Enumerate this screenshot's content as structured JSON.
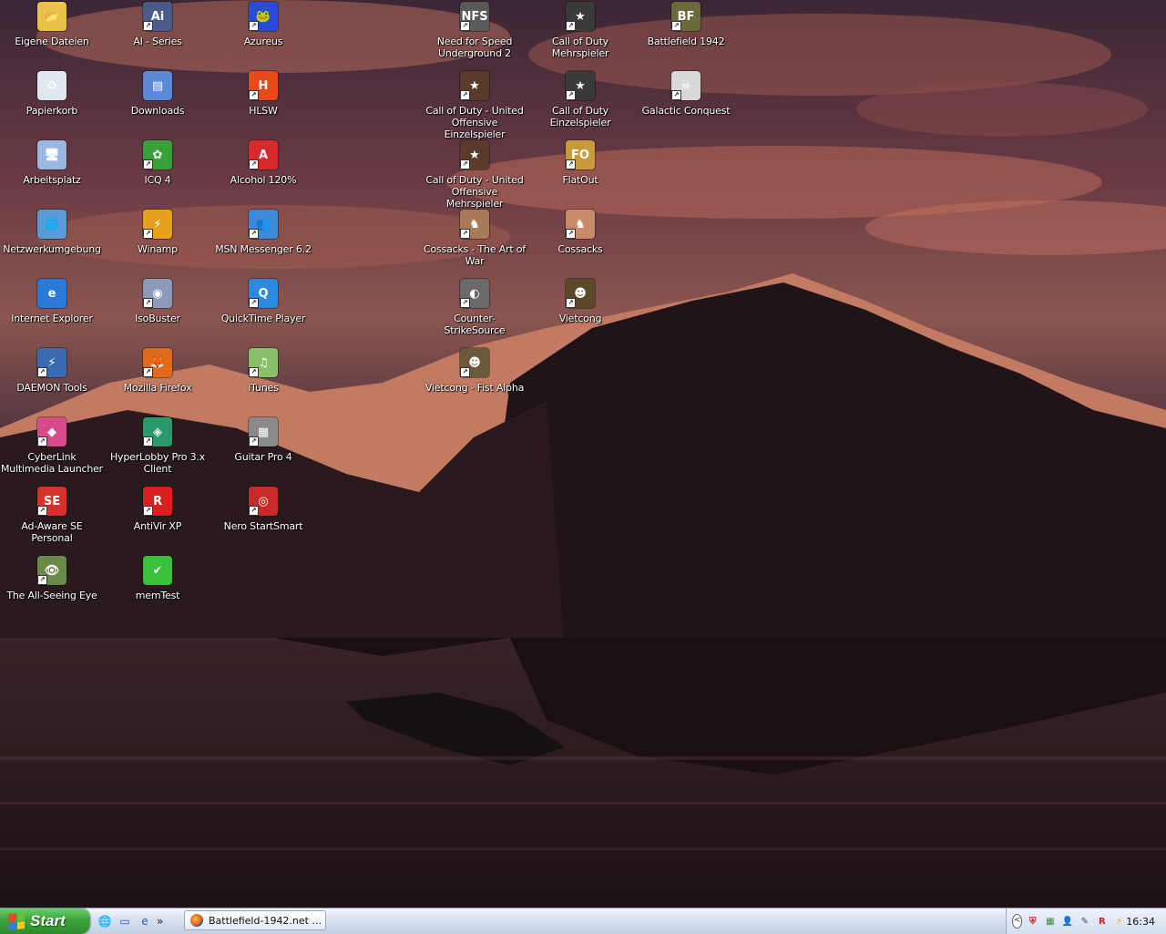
{
  "desktop": {
    "icons": [
      {
        "label": "Eigene Dateien",
        "glyph": "📂",
        "color": "#e9c24a",
        "shortcut": false
      },
      {
        "label": "Papierkorb",
        "glyph": "♻",
        "color": "#dfe8f0",
        "shortcut": false
      },
      {
        "label": "Arbeitsplatz",
        "glyph": "🖥",
        "color": "#9ab8e0",
        "shortcut": false
      },
      {
        "label": "Netzwerkumgebung",
        "glyph": "🌐",
        "color": "#5a9ad8",
        "shortcut": false
      },
      {
        "label": "Internet Explorer",
        "glyph": "e",
        "color": "#2a7ad8",
        "shortcut": false
      },
      {
        "label": "DAEMON Tools",
        "glyph": "⚡",
        "color": "#3a6ab0",
        "shortcut": true
      },
      {
        "label": "CyberLink Multimedia Launcher",
        "glyph": "◆",
        "color": "#d84a8a",
        "shortcut": true
      },
      {
        "label": "Ad-Aware SE Personal",
        "glyph": "SE",
        "color": "#d8302a",
        "shortcut": true
      },
      {
        "label": "The All-Seeing Eye",
        "glyph": "👁",
        "color": "#6a8a4a",
        "shortcut": true
      },
      {
        "label": "AI - Series",
        "glyph": "Ai",
        "color": "#4a5a8a",
        "shortcut": true
      },
      {
        "label": "Downloads",
        "glyph": "▤",
        "color": "#5a8ad8",
        "shortcut": false
      },
      {
        "label": "ICQ 4",
        "glyph": "✿",
        "color": "#3aa03a",
        "shortcut": true
      },
      {
        "label": "Winamp",
        "glyph": "⚡",
        "color": "#e8a020",
        "shortcut": true
      },
      {
        "label": "IsoBuster",
        "glyph": "◉",
        "color": "#8a9ab8",
        "shortcut": true
      },
      {
        "label": "Mozilla Firefox",
        "glyph": "🦊",
        "color": "#e06a1a",
        "shortcut": true
      },
      {
        "label": "HyperLobby Pro 3.x Client",
        "glyph": "◈",
        "color": "#2a9a6a",
        "shortcut": true
      },
      {
        "label": "AntiVir XP",
        "glyph": "R",
        "color": "#d82020",
        "shortcut": true
      },
      {
        "label": "memTest",
        "glyph": "✔",
        "color": "#3ac03a",
        "shortcut": false
      },
      {
        "label": "Azureus",
        "glyph": "🐸",
        "color": "#2a4ad8",
        "shortcut": true
      },
      {
        "label": "HLSW",
        "glyph": "H",
        "color": "#e84a1a",
        "shortcut": true
      },
      {
        "label": "Alcohol 120%",
        "glyph": "A",
        "color": "#d82a2a",
        "shortcut": true
      },
      {
        "label": "MSN Messenger 6.2",
        "glyph": "👥",
        "color": "#3a8ad8",
        "shortcut": true
      },
      {
        "label": "QuickTime Player",
        "glyph": "Q",
        "color": "#2a8ae0",
        "shortcut": true
      },
      {
        "label": "iTunes",
        "glyph": "♫",
        "color": "#8ac06a",
        "shortcut": true
      },
      {
        "label": "Guitar Pro 4",
        "glyph": "▦",
        "color": "#8a8a8a",
        "shortcut": true
      },
      {
        "label": "Nero StartSmart",
        "glyph": "◎",
        "color": "#c82a2a",
        "shortcut": true
      },
      {
        "label": "Need for Speed Underground 2",
        "glyph": "NFS",
        "color": "#5a5a5a",
        "shortcut": true
      },
      {
        "label": "Call of Duty - United Offensive Einzelspieler",
        "glyph": "★",
        "color": "#5a3a2a",
        "shortcut": true
      },
      {
        "label": "Call of Duty - United Offensive Mehrspieler",
        "glyph": "★",
        "color": "#5a3a2a",
        "shortcut": true
      },
      {
        "label": "Cossacks - The Art of War",
        "glyph": "♞",
        "color": "#a87a5a",
        "shortcut": true
      },
      {
        "label": "Counter-StrikeSource",
        "glyph": "◐",
        "color": "#6a6a6a",
        "shortcut": true
      },
      {
        "label": "Vietcong - Fist Alpha",
        "glyph": "☻",
        "color": "#6a5a3a",
        "shortcut": true
      },
      {
        "label": "Call of Duty Mehrspieler",
        "glyph": "★",
        "color": "#3a3a3a",
        "shortcut": true
      },
      {
        "label": "Call of Duty Einzelspieler",
        "glyph": "★",
        "color": "#3a3a3a",
        "shortcut": true
      },
      {
        "label": "FlatOut",
        "glyph": "FO",
        "color": "#c89a3a",
        "shortcut": true
      },
      {
        "label": "Cossacks",
        "glyph": "♞",
        "color": "#c88a6a",
        "shortcut": true
      },
      {
        "label": "Vietcong",
        "glyph": "☻",
        "color": "#5a4a2a",
        "shortcut": true
      },
      {
        "label": "Battlefield 1942",
        "glyph": "BF",
        "color": "#6a6a3a",
        "shortcut": true
      },
      {
        "label": "Galactic Conquest",
        "glyph": "☠",
        "color": "#d8d8d8",
        "shortcut": true
      }
    ]
  },
  "taskbar": {
    "start_label": "Start",
    "quick_launch": [
      {
        "name": "ql-browser",
        "glyph": "🌐"
      },
      {
        "name": "ql-show-desktop",
        "glyph": "▭"
      },
      {
        "name": "ql-internet-explorer",
        "glyph": "e"
      }
    ],
    "more_glyph": "»",
    "task_label": "Battlefield-1942.net ...",
    "tray_toggle_glyph": "<",
    "tray_icons": [
      {
        "name": "antivir-tray-icon",
        "glyph": "⛨",
        "color": "#c82020"
      },
      {
        "name": "network-tray-icon",
        "glyph": "▦",
        "color": "#3a8a3a"
      },
      {
        "name": "msn-tray-icon",
        "glyph": "👤",
        "color": "#3a6ad8"
      },
      {
        "name": "tool-tray-icon",
        "glyph": "✎",
        "color": "#2a4a8a"
      },
      {
        "name": "antivir-umbrella-tray-icon",
        "glyph": "R",
        "color": "#d82020"
      },
      {
        "name": "winamp-tray-icon",
        "glyph": "⚡",
        "color": "#e8a020"
      }
    ],
    "clock": "16:34",
    "colors": {
      "start": "#3aa43a",
      "taskbar": "#d9e2f1"
    }
  }
}
